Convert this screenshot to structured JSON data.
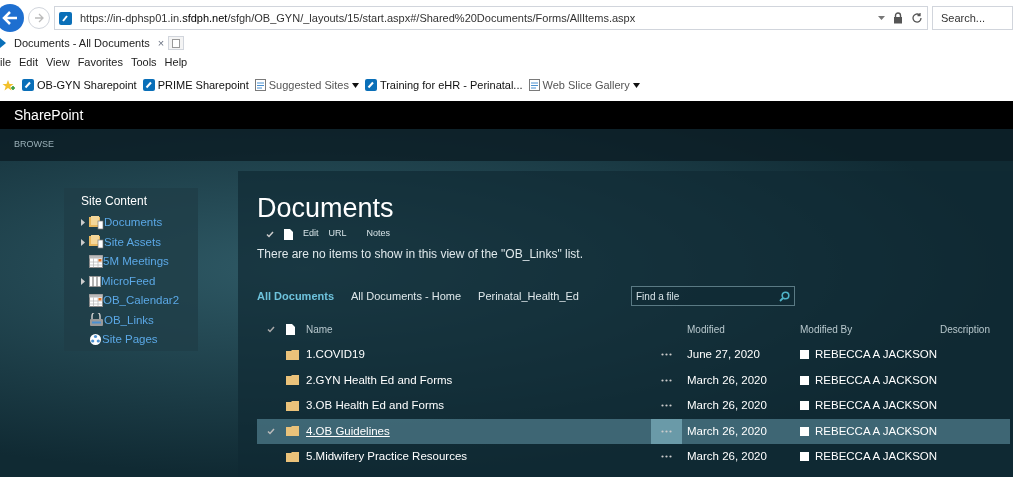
{
  "browser": {
    "address": {
      "prefix": "https://in-dphsp01.in.",
      "domain": "sfdph.net",
      "path": "/sfgh/OB_GYN/_layouts/15/start.aspx#/Shared%20Documents/Forms/AllItems.aspx"
    },
    "search_placeholder": "Search...",
    "tab_title": "Documents - All Documents",
    "tab_close": "×",
    "menu": [
      "ile",
      "Edit",
      "View",
      "Favorites",
      "Tools",
      "Help"
    ],
    "favorites": [
      {
        "label": "OB-GYN Sharepoint",
        "kind": "sharepoint",
        "dropdown": false
      },
      {
        "label": "PRIME Sharepoint",
        "kind": "sharepoint",
        "dropdown": false
      },
      {
        "label": "Suggested Sites",
        "kind": "page",
        "dropdown": true
      },
      {
        "label": "Training for eHR - Perinatal...",
        "kind": "sharepoint",
        "dropdown": false
      },
      {
        "label": "Web Slice Gallery",
        "kind": "page",
        "dropdown": true
      }
    ]
  },
  "suite_bar": {
    "title": "SharePoint"
  },
  "ribbon": {
    "tab": "BROWSE"
  },
  "nav": {
    "heading": "Site Content",
    "items": [
      {
        "label": "Documents",
        "kind": "library",
        "expandable": true
      },
      {
        "label": "Site Assets",
        "kind": "library",
        "expandable": true
      },
      {
        "label": "5M Meetings",
        "kind": "calendar",
        "expandable": false
      },
      {
        "label": "MicroFeed",
        "kind": "list",
        "expandable": true
      },
      {
        "label": "OB_Calendar2",
        "kind": "calendar",
        "expandable": false
      },
      {
        "label": "OB_Links",
        "kind": "links",
        "expandable": false
      },
      {
        "label": "Site Pages",
        "kind": "pages",
        "expandable": false
      }
    ]
  },
  "page": {
    "title": "Documents",
    "toolbar": [
      "Edit",
      "URL",
      "Notes"
    ],
    "message": "There are no items to show in this view of the \"OB_Links\" list.",
    "views": [
      {
        "label": "All Documents",
        "selected": true
      },
      {
        "label": "All Documents - Home",
        "selected": false
      },
      {
        "label": "Perinatal_Health_Ed",
        "selected": false
      }
    ],
    "search_placeholder": "Find a file",
    "columns": [
      "Name",
      "Modified",
      "Modified By",
      "Description"
    ],
    "rows": [
      {
        "name": "1.COVID19",
        "modified": "June 27, 2020",
        "modified_by": "REBECCA A JACKSON",
        "selected": false
      },
      {
        "name": "2.GYN Health Ed and Forms",
        "modified": "March 26, 2020",
        "modified_by": "REBECCA A JACKSON",
        "selected": false
      },
      {
        "name": "3.OB Health Ed and Forms",
        "modified": "March 26, 2020",
        "modified_by": "REBECCA A JACKSON",
        "selected": false
      },
      {
        "name": "4.OB Guidelines",
        "modified": "March 26, 2020",
        "modified_by": "REBECCA A JACKSON",
        "selected": true
      },
      {
        "name": "5.Midwifery Practice Resources",
        "modified": "March 26, 2020",
        "modified_by": "REBECCA A JACKSON",
        "selected": false
      }
    ]
  }
}
